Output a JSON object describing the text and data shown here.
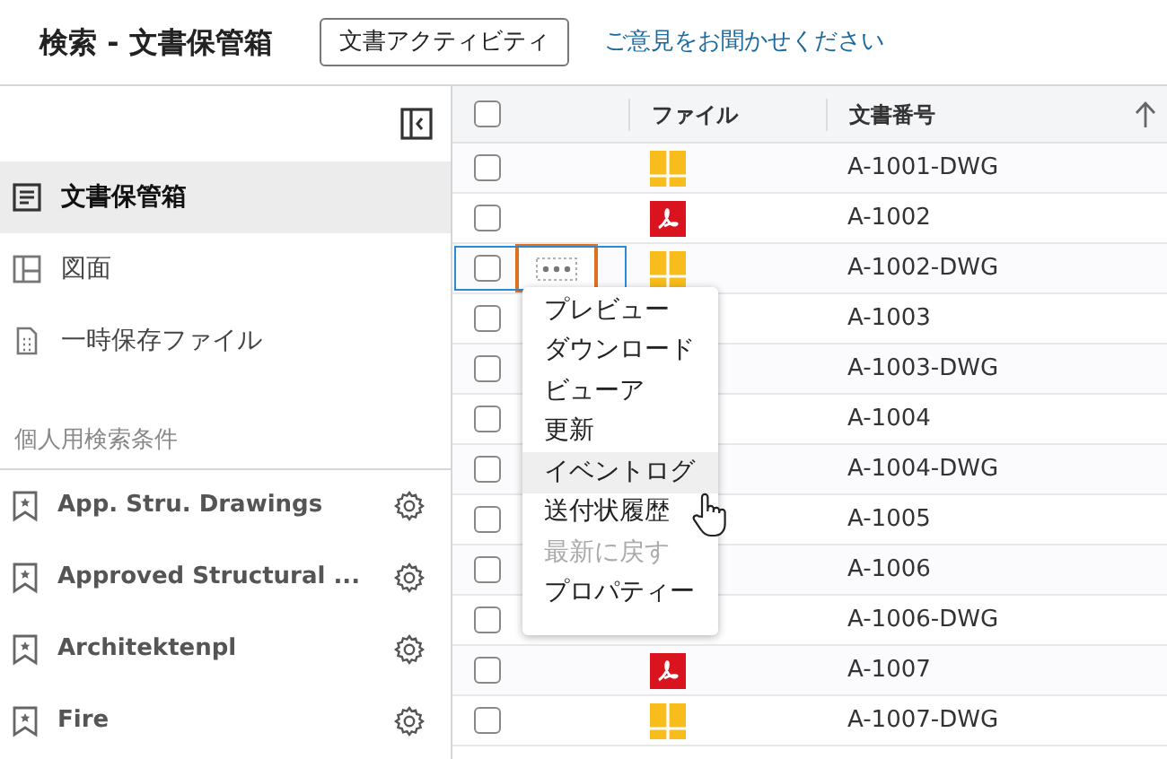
{
  "header": {
    "title": "検索 - 文書保管箱",
    "activity_button": "文書アクティビティ",
    "feedback_link": "ご意見をお聞かせください"
  },
  "sidebar": {
    "nav": [
      {
        "label": "文書保管箱",
        "kind": "document",
        "selected": true
      },
      {
        "label": "図面",
        "kind": "layout",
        "selected": false
      },
      {
        "label": "一時保存ファイル",
        "kind": "temp",
        "selected": false
      }
    ],
    "section_title": "個人用検索条件",
    "saved_searches": [
      {
        "label": "App. Stru. Drawings"
      },
      {
        "label": "Approved Structural ..."
      },
      {
        "label": "Architektenpl"
      },
      {
        "label": "Fire"
      }
    ]
  },
  "table": {
    "header_checked": false,
    "columns": [
      "ファイル",
      "文書番号"
    ],
    "rows": [
      {
        "checked": false,
        "focused": false,
        "kind": "dwg",
        "number": "A-1001-DWG"
      },
      {
        "checked": false,
        "focused": false,
        "kind": "pdf",
        "number": "A-1002"
      },
      {
        "checked": false,
        "focused": true,
        "kind": "dwg",
        "number": "A-1002-DWG"
      },
      {
        "checked": false,
        "focused": false,
        "number": "A-1003"
      },
      {
        "checked": false,
        "focused": false,
        "number": "A-1003-DWG"
      },
      {
        "checked": false,
        "focused": false,
        "number": "A-1004"
      },
      {
        "checked": false,
        "focused": false,
        "number": "A-1004-DWG"
      },
      {
        "checked": false,
        "focused": false,
        "number": "A-1005"
      },
      {
        "checked": false,
        "focused": false,
        "number": "A-1006"
      },
      {
        "checked": false,
        "focused": false,
        "number": "A-1006-DWG"
      },
      {
        "checked": false,
        "focused": false,
        "kind": "pdf",
        "number": "A-1007"
      },
      {
        "checked": false,
        "focused": false,
        "kind": "dwg",
        "number": "A-1007-DWG"
      }
    ]
  },
  "context_menu": {
    "items": [
      {
        "label": "プレビュー",
        "hovered": false,
        "disabled": false
      },
      {
        "label": "ダウンロード",
        "hovered": false,
        "disabled": false
      },
      {
        "label": "ビューア",
        "hovered": false,
        "disabled": false
      },
      {
        "label": "更新",
        "hovered": false,
        "disabled": false
      },
      {
        "label": "イベントログ",
        "hovered": true,
        "disabled": false
      },
      {
        "label": "送付状履歴",
        "hovered": false,
        "disabled": false
      },
      {
        "label": "最新に戻す",
        "hovered": false,
        "disabled": true
      },
      {
        "label": "プロパティー",
        "hovered": false,
        "disabled": false
      }
    ]
  }
}
